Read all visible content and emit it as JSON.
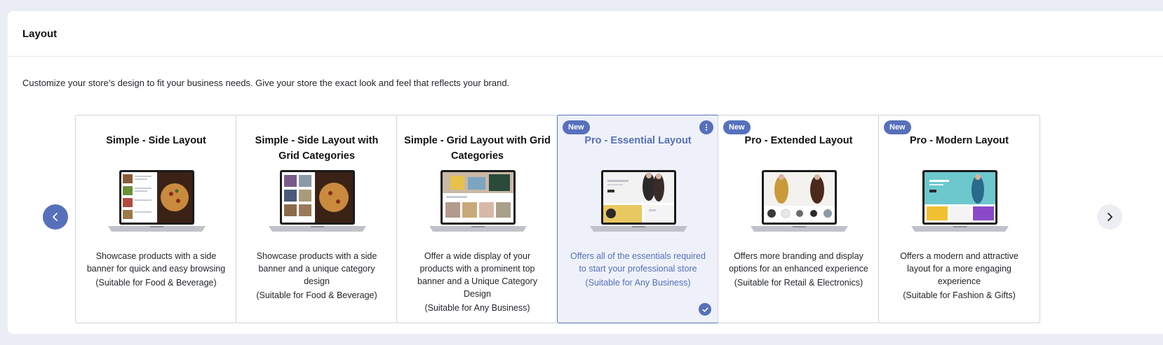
{
  "panel": {
    "title": "Layout",
    "description": "Customize your store’s design to fit your business needs. Give your store the exact look and feel that reflects your brand."
  },
  "carousel": {
    "prev_icon": "chevron-left-icon",
    "next_icon": "chevron-right-icon",
    "cards": [
      {
        "title": "Simple - Side Layout",
        "description": "Showcase products with a side banner for quick and easy browsing",
        "suitability": "(Suitable for Food & Beverage)",
        "badge": "",
        "selected": false
      },
      {
        "title": "Simple - Side Layout with Grid Categories",
        "description": "Showcase products with a side banner and a unique category design",
        "suitability": "(Suitable for Food & Beverage)",
        "badge": "",
        "selected": false
      },
      {
        "title": "Simple - Grid Layout with Grid Categories",
        "description": "Offer a wide display of your products with a prominent top banner and a Unique Category Design",
        "suitability": "(Suitable for Any Business)",
        "badge": "",
        "selected": false
      },
      {
        "title": "Pro - Essential Layout",
        "description": "Offers all of the essentials required to start your professional store",
        "suitability": "(Suitable for Any Business)",
        "badge": "New",
        "selected": true
      },
      {
        "title": "Pro - Extended Layout",
        "description": "Offers more branding and display options for an enhanced experience",
        "suitability": "(Suitable for Retail & Electronics)",
        "badge": "New",
        "selected": false
      },
      {
        "title": "Pro - Modern Layout",
        "description": "Offers a modern and attractive layout for a more engaging experience",
        "suitability": "(Suitable for Fashion & Gifts)",
        "badge": "New",
        "selected": false
      }
    ]
  },
  "colors": {
    "accent": "#5670bb",
    "selected_bg": "#eef1f9",
    "page_bg": "#eaeef4"
  }
}
